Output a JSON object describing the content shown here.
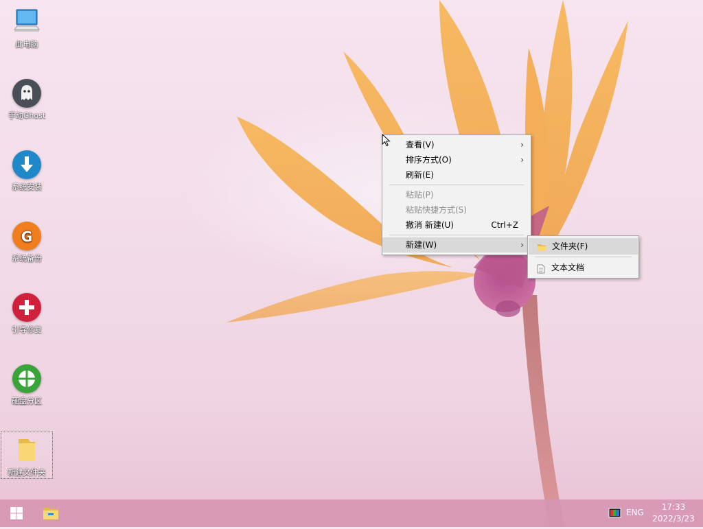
{
  "desktop": {
    "icons": [
      {
        "label": "此电脑",
        "icon": "this-pc-icon"
      },
      {
        "label": "手动Ghost",
        "icon": "ghost-icon"
      },
      {
        "label": "系统安装",
        "icon": "system-install-icon"
      },
      {
        "label": "系统备份",
        "icon": "system-backup-icon"
      },
      {
        "label": "引导修复",
        "icon": "boot-repair-icon"
      },
      {
        "label": "硬盘分区",
        "icon": "disk-partition-icon"
      },
      {
        "label": "新建文件夹",
        "icon": "folder-icon"
      }
    ]
  },
  "context_menu": {
    "items": [
      {
        "label": "查看(V)",
        "submenu": true
      },
      {
        "label": "排序方式(O)",
        "submenu": true
      },
      {
        "label": "刷新(E)"
      },
      {
        "label": "粘贴(P)",
        "disabled": true
      },
      {
        "label": "粘贴快捷方式(S)",
        "disabled": true
      },
      {
        "label": "撤消 新建(U)",
        "shortcut": "Ctrl+Z"
      },
      {
        "label": "新建(W)",
        "submenu": true,
        "active": true
      }
    ],
    "arrow_glyph": "›"
  },
  "new_submenu": {
    "items": [
      {
        "label": "文件夹(F)",
        "icon": "folder-icon"
      },
      {
        "label": "文本文档",
        "icon": "text-document-icon"
      }
    ]
  },
  "taskbar": {
    "start": "start-icon",
    "pinned": [
      "file-explorer-icon"
    ],
    "tray": {
      "language": "ENG",
      "time": "17:33",
      "date": "2022/3/23"
    }
  },
  "colors": {
    "ghost": "#4a4f57",
    "install": "#1e88c8",
    "backup": "#f07d1e",
    "repair": "#d0203c",
    "partition": "#3aa43a",
    "taskbar": "#d696b2"
  }
}
